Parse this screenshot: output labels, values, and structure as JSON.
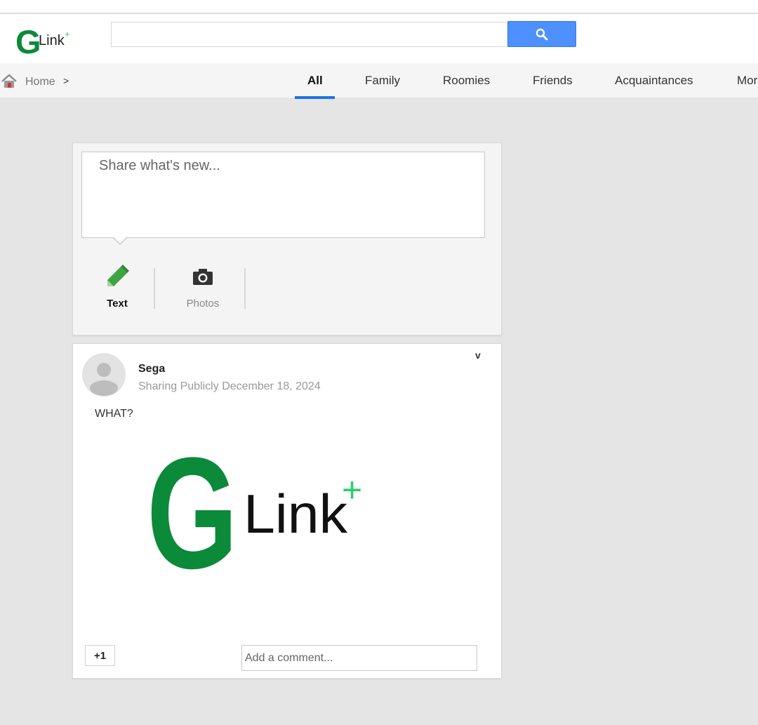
{
  "header": {
    "logo": {
      "letter": "G",
      "word": "Link",
      "sup": "+",
      "color": "#0b8a3a",
      "plus_color": "#2ecc71"
    },
    "search": {
      "placeholder": "",
      "value": "",
      "button_icon": "search-icon",
      "button_color": "#4d90fe"
    }
  },
  "nav": {
    "breadcrumb": {
      "home_label": "Home",
      "separator": ">"
    },
    "tabs": [
      {
        "label": "All",
        "active": true
      },
      {
        "label": "Family"
      },
      {
        "label": "Roomies"
      },
      {
        "label": "Friends"
      },
      {
        "label": "Acquaintances"
      },
      {
        "label": "Mor"
      }
    ],
    "active_color": "#1a73e8"
  },
  "share": {
    "placeholder": "Share what's new...",
    "types": [
      {
        "label": "Text",
        "icon": "pencil-icon",
        "active": true
      },
      {
        "label": "Photos",
        "icon": "camera-icon"
      }
    ]
  },
  "post": {
    "author": "Sega",
    "visibility": "Sharing Publicly",
    "date": "December 18, 2024",
    "menu_glyph": "v",
    "text": "WHAT?",
    "image": {
      "letter": "G",
      "word": "Link",
      "sup": "+"
    },
    "plus_one_label": "+1",
    "comment_placeholder": "Add a comment..."
  }
}
